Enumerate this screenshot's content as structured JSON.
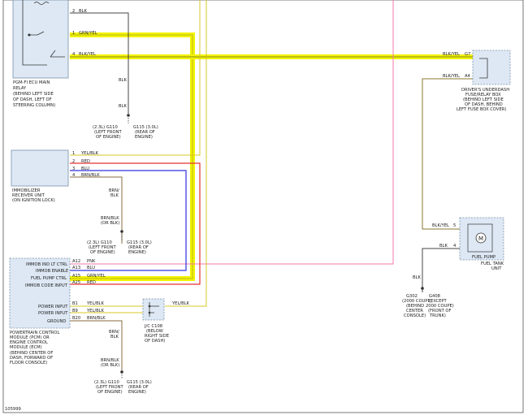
{
  "figure_id": "105999",
  "colors": {
    "highlight": "#f3f300",
    "highlight_edge": "#c8c800",
    "blk": "#444444",
    "grn_yel": "#c8c830",
    "red": "#e53030",
    "blu": "#3030e0",
    "pnk": "#f27aa8",
    "yel_blk": "#d6c82a",
    "brn_blk": "#8a6a40",
    "box_fill": "#dde8f4",
    "box_edge": "#7890a8"
  },
  "main_relay": {
    "label": [
      "PGM-FI ECU MAIN",
      "RELAY",
      "(BEHIND LEFT SIDE",
      "OF DASH, LEFT OF",
      "STEERING COLUMN)"
    ],
    "pins": [
      {
        "pin": "2",
        "wire": "BLK"
      },
      {
        "pin": "1",
        "wire": "GRN/YEL"
      },
      {
        "pin": "4",
        "wire": "BLK/YEL"
      }
    ]
  },
  "ground_top": {
    "wire_labels": [
      "BLK",
      "BLK"
    ],
    "g110": [
      "(2.3L) G110",
      "(LEFT FRONT",
      "OF ENGINE)"
    ],
    "g115": [
      "G115 (3.0L)",
      "(REAR OF",
      "ENGINE)"
    ]
  },
  "immobilizer": {
    "label": [
      "IMMOBILIZER",
      "RECEIVER UNIT",
      "(ON IGNITION LOCK)"
    ],
    "pins": [
      {
        "pin": "1",
        "wire": "YEL/BLK"
      },
      {
        "pin": "2",
        "wire": "RED"
      },
      {
        "pin": "3",
        "wire": "BLU"
      },
      {
        "pin": "4",
        "wire": "BRN/BLK"
      }
    ]
  },
  "ground_mid": {
    "wire_labels": [
      "BRN/",
      "BLK",
      "BRN/BLK",
      "(OR BLK)"
    ],
    "g110": [
      "(2.3L) G110",
      "(LEFT FRONT",
      "OF ENGINE)"
    ],
    "g115": [
      "G115 (3.0L)",
      "(REAR OF",
      "ENGINE)"
    ]
  },
  "pcm": {
    "label": [
      "POWERTRAIN CONTROL",
      "MODULE (PCM) OR",
      "ENGINE CONTROL",
      "MODULE (ECM)",
      "(BEHIND CENTER OF",
      "DASH, FORWARD OF",
      "FLOOR CONSOLE)"
    ],
    "pins": [
      {
        "name": "IMMOB IND LT CTRL",
        "pin": "A12",
        "wire": "PNK"
      },
      {
        "name": "IMMOB ENABLE",
        "pin": "A13",
        "wire": "BLU"
      },
      {
        "name": "FUEL PUMP CTRL",
        "pin": "A15",
        "wire": "GRN/YEL"
      },
      {
        "name": "IMMOB CODE INPUT",
        "pin": "A25",
        "wire": "RED"
      },
      {
        "name": "POWER INPUT",
        "pin": "B1",
        "wire": "YEL/BLK"
      },
      {
        "name": "POWER INPUT",
        "pin": "B9",
        "wire": "YEL/BLK"
      },
      {
        "name": "GROUND",
        "pin": "B20",
        "wire": "BRN/BLK"
      }
    ]
  },
  "jc108": {
    "label": [
      "J/C C108",
      "(BELOW",
      "RIGHT SIDE",
      "OF DASH)"
    ],
    "wire": "YEL/BLK"
  },
  "ground_bot": {
    "wire_labels": [
      "BRN/",
      "BLK",
      "BRN/BLK",
      "(OR BLK)"
    ],
    "g110": [
      "(2.3L) G110",
      "(LEFT FRONT",
      "OF ENGINE)"
    ],
    "g115": [
      "G115 (3.0L)",
      "(REAR OF",
      "ENGINE)"
    ]
  },
  "fuse_box": {
    "label": [
      "DRIVER'S UNDERDASH",
      "FUSE/RELAY BOX",
      "(BEHIND LEFT SIDE",
      "OF DASH, BEHIND",
      "LEFT FUSE BOX COVER)"
    ],
    "pins": [
      {
        "pin": "G7",
        "wire": "BLK/YEL"
      },
      {
        "pin": "A4",
        "wire": "BLK/YEL"
      }
    ]
  },
  "fuel_pump": {
    "label": [
      "FUEL PUMP",
      "FUEL TANK",
      "UNIT"
    ],
    "symbol": "M",
    "pins": [
      {
        "pin": "5",
        "wire": "BLK/YEL"
      },
      {
        "pin": "4",
        "wire": "BLK"
      }
    ],
    "ground_wire": "BLK"
  },
  "g302": [
    "G302",
    "(2000 COUPE)",
    "(BEHIND",
    "CENTER",
    "CONSOLE)"
  ],
  "g408": [
    "G408",
    "(EXCEPT",
    "2000 COUPE)",
    "(FRONT OF",
    "TRUNK)"
  ]
}
